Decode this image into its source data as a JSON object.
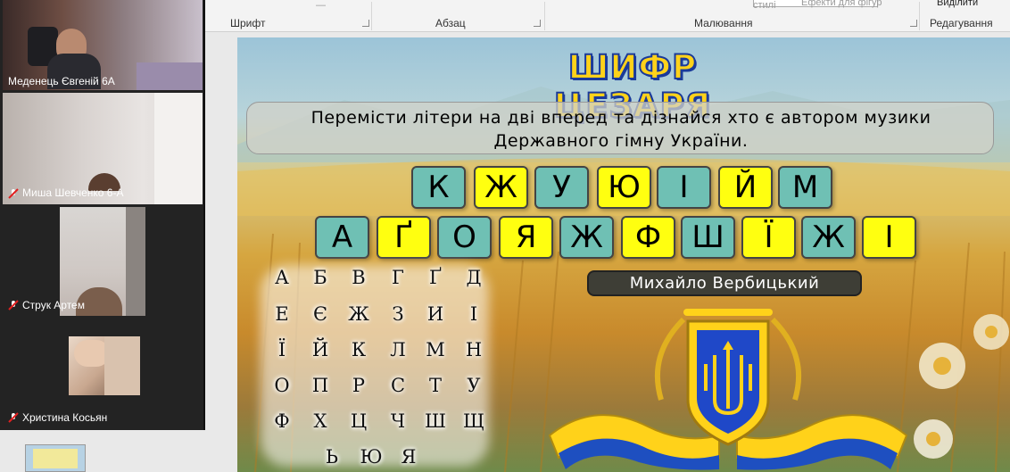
{
  "ribbon": {
    "groups": [
      "Шрифт",
      "Абзац",
      "Малювання",
      "Редагування"
    ],
    "styles_label": "стилі",
    "effects_label": "Ефекти для фігур",
    "select_label": "Виділити"
  },
  "participants": [
    {
      "name": "Меденець Євгеній 6А",
      "muted": false
    },
    {
      "name": "Миша Шевченко 6-А",
      "muted": true
    },
    {
      "name": "Струк Артем",
      "muted": true
    },
    {
      "name": "Христина Косьян",
      "muted": true
    }
  ],
  "slide": {
    "title": "ШИФР ЦЕЗАРЯ",
    "instruction_line1": "Перемісти літери на дві вперед та дізнайся хто є автором музики",
    "instruction_line2": "Державного гімну України.",
    "row1": [
      {
        "ch": "К",
        "color": "teal"
      },
      {
        "ch": "Ж",
        "color": "yellow"
      },
      {
        "ch": "У",
        "color": "teal"
      },
      {
        "ch": "Ю",
        "color": "yellow"
      },
      {
        "ch": "І",
        "color": "teal"
      },
      {
        "ch": "Й",
        "color": "yellow"
      },
      {
        "ch": "М",
        "color": "teal"
      }
    ],
    "row2": [
      {
        "ch": "А",
        "color": "teal"
      },
      {
        "ch": "Ґ",
        "color": "yellow"
      },
      {
        "ch": "О",
        "color": "teal"
      },
      {
        "ch": "Я",
        "color": "yellow"
      },
      {
        "ch": "Ж",
        "color": "teal"
      },
      {
        "ch": "Ф",
        "color": "yellow"
      },
      {
        "ch": "Ш",
        "color": "teal"
      },
      {
        "ch": "Ї",
        "color": "yellow"
      },
      {
        "ch": "Ж",
        "color": "teal"
      },
      {
        "ch": "І",
        "color": "yellow"
      }
    ],
    "answer": "Михайло Вербицький",
    "alphabet": [
      [
        "А",
        "Б",
        "В",
        "Г",
        "Ґ",
        "Д"
      ],
      [
        "Е",
        "Є",
        "Ж",
        "З",
        "И",
        "І"
      ],
      [
        "Ї",
        "Й",
        "К",
        "Л",
        "М",
        "Н"
      ],
      [
        "О",
        "П",
        "Р",
        "С",
        "Т",
        "У"
      ],
      [
        "Ф",
        "Х",
        "Ц",
        "Ч",
        "Ш",
        "Щ"
      ],
      [
        "Ь",
        "Ю",
        "Я"
      ]
    ]
  },
  "colors": {
    "teal": "#6fc0b4",
    "yellow": "#ffff10",
    "title_fill": "#ffd21a",
    "title_stroke": "#1a3a9a"
  }
}
